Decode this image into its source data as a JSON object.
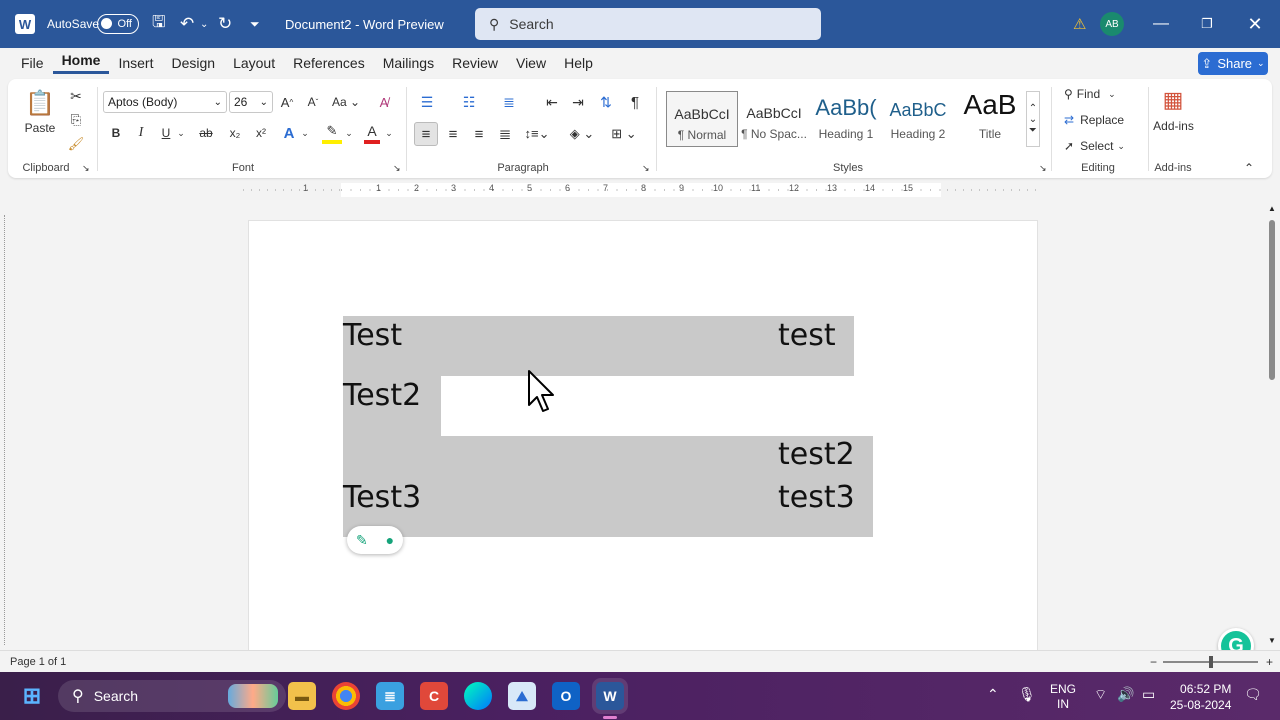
{
  "titlebar": {
    "autosave_label": "AutoSave",
    "autosave_state": "Off",
    "doc_title": "Document2  -  Word Preview",
    "search_placeholder": "Search",
    "avatar": "AB",
    "warning_icon": "warning-icon"
  },
  "menu": [
    "File",
    "Home",
    "Insert",
    "Design",
    "Layout",
    "References",
    "Mailings",
    "Review",
    "View",
    "Help"
  ],
  "share_label": "Share",
  "ribbon": {
    "clipboard": {
      "paste": "Paste",
      "label": "Clipboard"
    },
    "font": {
      "name": "Aptos (Body)",
      "size": "26",
      "label": "Font",
      "bold": "B",
      "italic": "I",
      "underline": "U",
      "strike": "ab",
      "sub": "x₂",
      "sup": "x²"
    },
    "paragraph": {
      "label": "Paragraph"
    },
    "styles": {
      "label": "Styles",
      "items": [
        {
          "preview": "AaBbCcI",
          "name": "¶ Normal"
        },
        {
          "preview": "AaBbCcI",
          "name": "¶ No Spac..."
        },
        {
          "preview": "AaBb(",
          "name": "Heading 1"
        },
        {
          "preview": "AaBbC",
          "name": "Heading 2"
        },
        {
          "preview": "AaB",
          "name": "Title"
        }
      ]
    },
    "editing": {
      "find": "Find",
      "replace": "Replace",
      "select": "Select",
      "label": "Editing"
    },
    "addins": {
      "button": "Add-ins",
      "label": "Add-ins"
    }
  },
  "ruler_numbers": [
    "1",
    "1",
    "2",
    "3",
    "4",
    "5",
    "6",
    "7",
    "8",
    "9",
    "10",
    "11",
    "12",
    "13",
    "14",
    "15"
  ],
  "document": {
    "lines": [
      {
        "left": "Test",
        "right": "test"
      },
      {
        "left": "Test2",
        "right": ""
      },
      {
        "left": "",
        "right": "test2"
      },
      {
        "left": "Test3",
        "right": "test3"
      }
    ]
  },
  "status": {
    "page": "Page 1 of 1"
  },
  "taskbar": {
    "search": "Search",
    "lang1": "ENG",
    "lang2": "IN",
    "time": "06:52 PM",
    "date": "25-08-2024"
  }
}
